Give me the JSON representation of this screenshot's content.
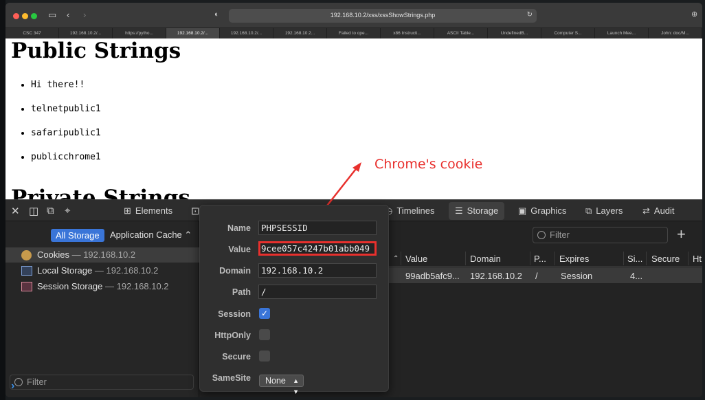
{
  "browser": {
    "url": "192.168.10.2/xss/xssShowStrings.php",
    "tabs": [
      {
        "label": "CSC 347",
        "active": false
      },
      {
        "label": "192.168.10.2/...",
        "active": false
      },
      {
        "label": "https://pytho...",
        "active": false
      },
      {
        "label": "192.168.10.2/...",
        "active": true
      },
      {
        "label": "192.168.10.2/...",
        "active": false
      },
      {
        "label": "192.168.10.2...",
        "active": false
      },
      {
        "label": "Failed to ope...",
        "active": false
      },
      {
        "label": "x86 Instructi...",
        "active": false
      },
      {
        "label": "ASCII Table...",
        "active": false
      },
      {
        "label": "UndefinedB...",
        "active": false
      },
      {
        "label": "Computer S...",
        "active": false
      },
      {
        "label": "Launch Mee...",
        "active": false
      },
      {
        "label": "John: doc/M...",
        "active": false
      }
    ]
  },
  "page": {
    "public_heading": "Public Strings",
    "public_items": [
      "Hi there!!",
      "telnetpublic1",
      "safaripublic1",
      "publicchrome1"
    ],
    "private_heading": "Private Strings",
    "annotation": "Chrome's cookie"
  },
  "devtools": {
    "tabs": {
      "elements": "Elements",
      "timelines": "Timelines",
      "storage": "Storage",
      "graphics": "Graphics",
      "layers": "Layers",
      "audit": "Audit"
    },
    "sidebar": {
      "all_storage": "All Storage",
      "application_cache": "Application Cache",
      "items": [
        {
          "label": "Cookies",
          "host": " — 192.168.10.2"
        },
        {
          "label": "Local Storage",
          "host": " — 192.168.10.2"
        },
        {
          "label": "Session Storage",
          "host": " — 192.168.10.2"
        }
      ],
      "filter_placeholder": "Filter"
    },
    "table": {
      "filter_placeholder": "Filter",
      "headers": [
        "Value",
        "Domain",
        "P...",
        "Expires",
        "Si...",
        "Secure",
        "Ht"
      ],
      "row": [
        "99adb5afc9...",
        "192.168.10.2",
        "/",
        "Session",
        "4..."
      ]
    },
    "popover": {
      "name_label": "Name",
      "name_value": "PHPSESSID",
      "value_label": "Value",
      "value_value": "9cee057c4247b01abb049",
      "domain_label": "Domain",
      "domain_value": "192.168.10.2",
      "path_label": "Path",
      "path_value": "/",
      "session_label": "Session",
      "session_checked": true,
      "httponly_label": "HttpOnly",
      "httponly_checked": false,
      "secure_label": "Secure",
      "secure_checked": false,
      "samesite_label": "SameSite",
      "samesite_value": "None"
    }
  },
  "colors": {
    "annotation_red": "#e8302d",
    "accent_blue": "#3a75d8"
  }
}
